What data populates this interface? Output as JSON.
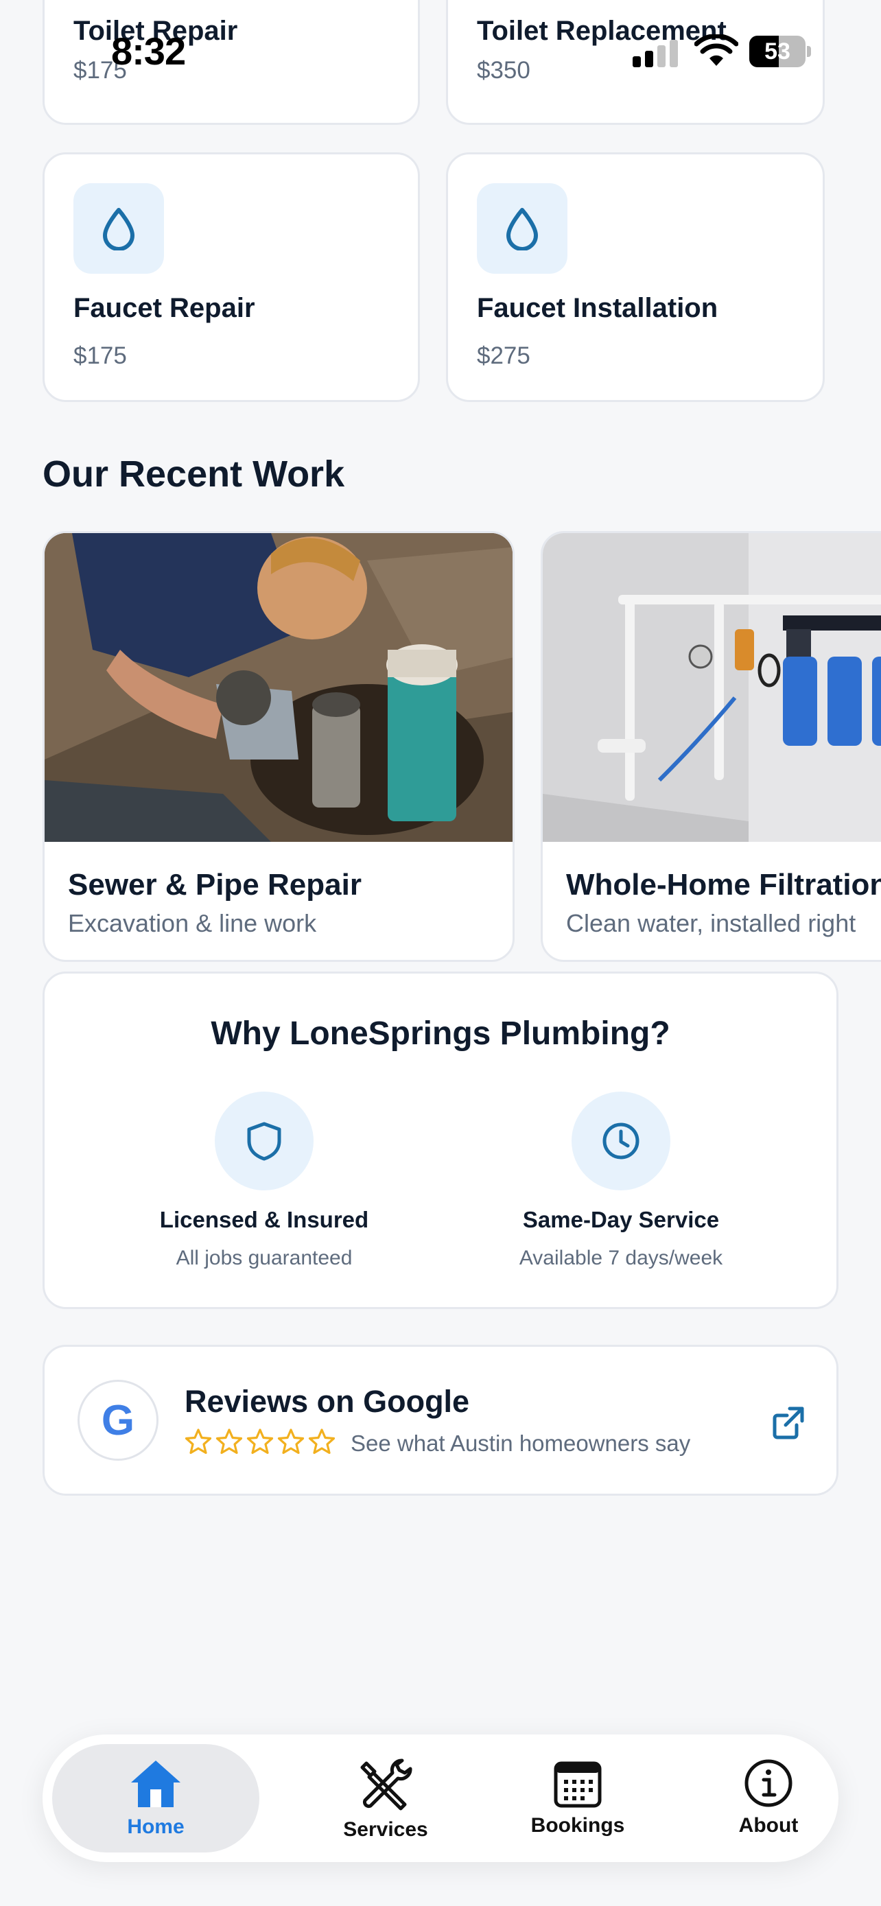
{
  "status_bar": {
    "time": "8:32",
    "battery": "53",
    "battery_level": 0.53
  },
  "services": [
    {
      "title": "Toilet Repair",
      "price": "$175",
      "icon": "drop-icon"
    },
    {
      "title": "Toilet Replacement",
      "price": "$350",
      "icon": "drop-icon"
    },
    {
      "title": "Faucet Repair",
      "price": "$175",
      "icon": "drop-icon"
    },
    {
      "title": "Faucet Installation",
      "price": "$275",
      "icon": "drop-icon"
    }
  ],
  "recent_work": {
    "heading": "Our Recent Work",
    "items": [
      {
        "title": "Sewer & Pipe Repair",
        "subtitle": "Excavation & line work"
      },
      {
        "title": "Whole-Home Filtration",
        "subtitle": "Clean water, installed right"
      }
    ]
  },
  "why": {
    "heading": "Why LoneSprings Plumbing?",
    "features": [
      {
        "title": "Licensed & Insured",
        "subtitle": "All jobs guaranteed",
        "icon": "shield-icon"
      },
      {
        "title": "Same-Day Service",
        "subtitle": "Available 7 days/week",
        "icon": "clock-icon"
      }
    ]
  },
  "reviews": {
    "logo": "G",
    "title": "Reviews on Google",
    "subtitle": "See what Austin homeowners say",
    "stars": 5
  },
  "tabs": [
    {
      "label": "Home",
      "icon": "home-icon",
      "active": true
    },
    {
      "label": "Services",
      "icon": "tools-icon",
      "active": false
    },
    {
      "label": "Bookings",
      "icon": "calendar-icon",
      "active": false
    },
    {
      "label": "About",
      "icon": "info-icon",
      "active": false
    }
  ],
  "colors": {
    "accent": "#1f7ae0",
    "icon_blue": "#1b6fa8",
    "star": "#f2b01e",
    "background": "#f6f7f9"
  }
}
